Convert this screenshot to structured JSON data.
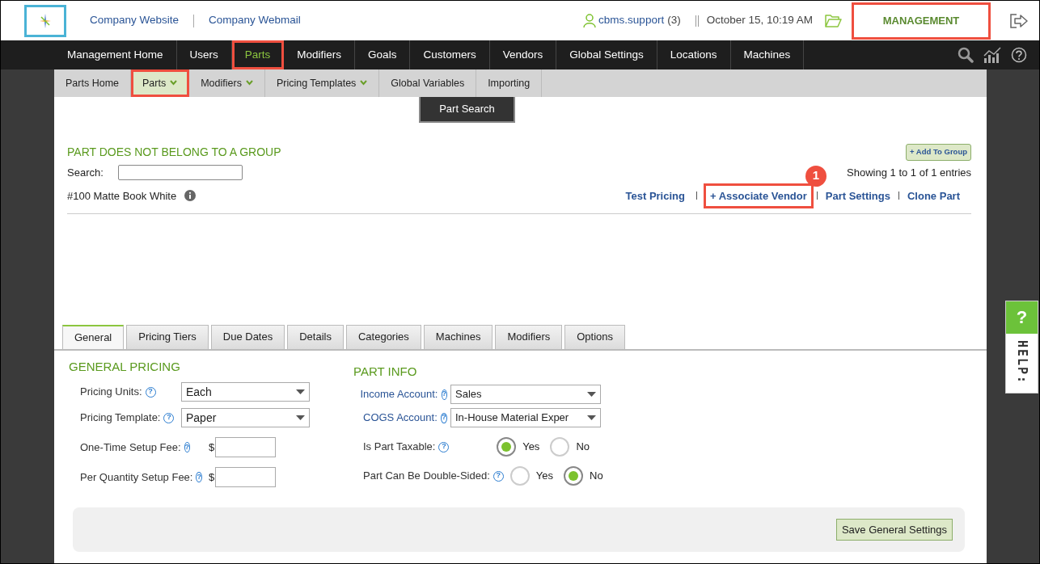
{
  "header": {
    "links": [
      "Company Website",
      "Company Webmail"
    ],
    "user": "cbms.support",
    "user_count": "(3)",
    "datetime": "October 15, 10:19 AM",
    "module": {
      "label": "MANAGEMENT",
      "highlighted": true
    }
  },
  "main_nav": [
    {
      "label": "Management Home",
      "selected": false,
      "highlighted": false
    },
    {
      "label": "Users",
      "selected": false,
      "highlighted": false
    },
    {
      "label": "Parts",
      "selected": true,
      "highlighted": true
    },
    {
      "label": "Modifiers",
      "selected": false,
      "highlighted": false
    },
    {
      "label": "Goals",
      "selected": false,
      "highlighted": false
    },
    {
      "label": "Customers",
      "selected": false,
      "highlighted": false
    },
    {
      "label": "Vendors",
      "selected": false,
      "highlighted": false
    },
    {
      "label": "Global Settings",
      "selected": false,
      "highlighted": false
    },
    {
      "label": "Locations",
      "selected": false,
      "highlighted": false
    },
    {
      "label": "Machines",
      "selected": false,
      "highlighted": false
    }
  ],
  "sub_nav": [
    {
      "label": "Parts Home",
      "dropdown": false,
      "selected": false,
      "highlighted": false
    },
    {
      "label": "Parts",
      "dropdown": true,
      "selected": true,
      "highlighted": true
    },
    {
      "label": "Modifiers",
      "dropdown": true,
      "selected": false,
      "highlighted": false
    },
    {
      "label": "Pricing Templates",
      "dropdown": true,
      "selected": false,
      "highlighted": false
    },
    {
      "label": "Global Variables",
      "dropdown": false,
      "selected": false,
      "highlighted": false
    },
    {
      "label": "Importing",
      "dropdown": false,
      "selected": false,
      "highlighted": false
    }
  ],
  "dropdown_menu": [
    "Part Search"
  ],
  "part_group": {
    "title": "PART DOES NOT BELONG TO A GROUP",
    "add_button": "+ Add To Group",
    "search_label": "Search:",
    "entries_info": "Showing 1 to 1 of 1 entries",
    "part_name": "#100 Matte Book White",
    "actions": [
      {
        "label": "Test Pricing",
        "highlighted": false
      },
      {
        "label": "+ Associate Vendor",
        "highlighted": true,
        "callout": "1"
      },
      {
        "label": "Part Settings",
        "highlighted": false
      },
      {
        "label": "Clone Part",
        "highlighted": false
      }
    ]
  },
  "tabs": [
    {
      "label": "General",
      "selected": true
    },
    {
      "label": "Pricing Tiers",
      "selected": false
    },
    {
      "label": "Due Dates",
      "selected": false
    },
    {
      "label": "Details",
      "selected": false
    },
    {
      "label": "Categories",
      "selected": false
    },
    {
      "label": "Machines",
      "selected": false
    },
    {
      "label": "Modifiers",
      "selected": false
    },
    {
      "label": "Options",
      "selected": false
    }
  ],
  "general_pricing": {
    "title": "GENERAL PRICING",
    "fields": [
      {
        "kind": "select",
        "label": "Pricing Units:",
        "value": "Each"
      },
      {
        "kind": "select",
        "label": "Pricing Template:",
        "value": "Paper"
      },
      {
        "kind": "money",
        "label": "One-Time Setup Fee:",
        "currency": "$"
      },
      {
        "kind": "money",
        "label": "Per Quantity Setup Fee:",
        "currency": "$"
      }
    ]
  },
  "part_info": {
    "title": "PART INFO",
    "fields": [
      {
        "kind": "select",
        "label": "Income Account:",
        "link": true,
        "value": "Sales"
      },
      {
        "kind": "select",
        "label": "COGS Account:",
        "link": true,
        "value": "In-House Material Exper"
      },
      {
        "kind": "radio",
        "label": "Is Part Taxable:",
        "options": [
          {
            "label": "Yes",
            "selected": true
          },
          {
            "label": "No",
            "selected": false
          }
        ]
      },
      {
        "kind": "radio",
        "label": "Part Can Be Double-Sided:",
        "options": [
          {
            "label": "Yes",
            "selected": false
          },
          {
            "label": "No",
            "selected": true
          }
        ]
      }
    ]
  },
  "save_button": "Save General Settings",
  "help_tab": {
    "icon": "?",
    "label": "HELP:"
  }
}
